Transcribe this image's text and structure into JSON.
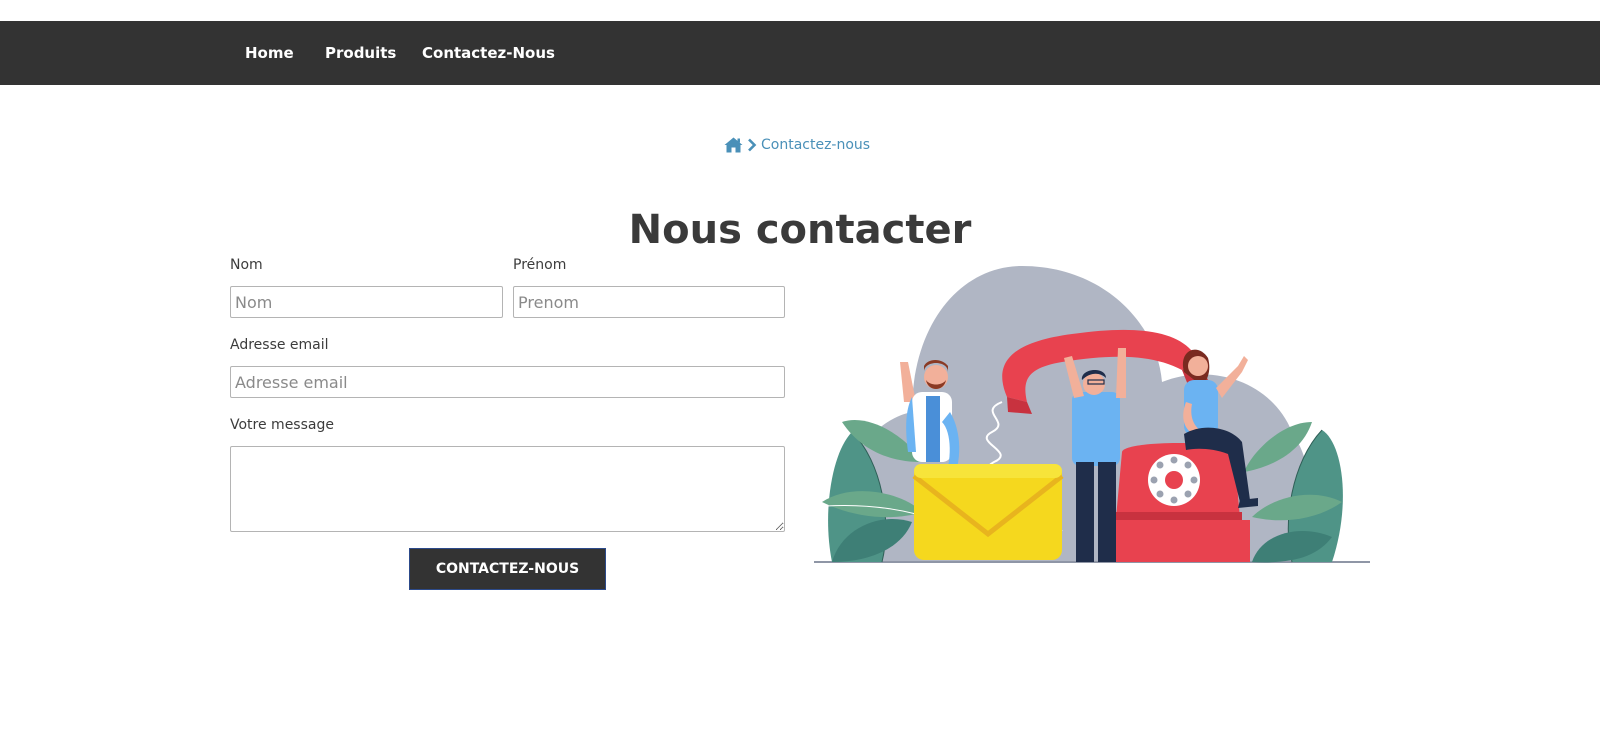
{
  "nav": {
    "items": [
      {
        "label": "Home"
      },
      {
        "label": "Produits"
      },
      {
        "label": "Contactez-Nous"
      }
    ]
  },
  "breadcrumb": {
    "home_icon": "home-icon",
    "separator_icon": "chevron-right-icon",
    "current": "Contactez-nous"
  },
  "page": {
    "title": "Nous contacter"
  },
  "form": {
    "nom_label": "Nom",
    "nom_placeholder": "Nom",
    "nom_value": "",
    "prenom_label": "Prénom",
    "prenom_placeholder": "Prenom",
    "prenom_value": "",
    "email_label": "Adresse email",
    "email_placeholder": "Adresse email",
    "email_value": "",
    "message_label": "Votre message",
    "message_value": "",
    "submit_label": "CONTACTEZ-NOUS"
  },
  "colors": {
    "navbar_bg": "#333333",
    "link_blue": "#4a90b8",
    "button_bg": "#333333",
    "phone_red": "#e8424f",
    "envelope_yellow": "#f5d81e",
    "blob_gray": "#b0b6c4",
    "leaf_green": "#4f9487"
  }
}
